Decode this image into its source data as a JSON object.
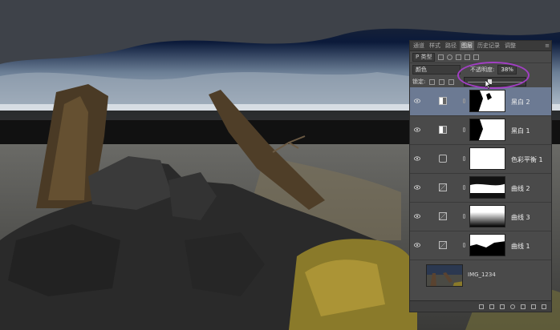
{
  "panel": {
    "tabs": [
      "通道",
      "样式",
      "路径",
      "图层",
      "历史记录",
      "调整"
    ],
    "active_tab": "图层",
    "kind_filter": "P 类型",
    "blend_mode": "颜色",
    "opacity_label": "不透明度:",
    "opacity_value": "38%",
    "lock_label": "锁定:",
    "opacity_slider": 0.38,
    "layers": [
      {
        "name": "黑白 2",
        "selected": true
      },
      {
        "name": "黑白 1",
        "selected": false
      },
      {
        "name": "色彩平衡 1",
        "selected": false
      },
      {
        "name": "曲线 2",
        "selected": false
      },
      {
        "name": "曲线 3",
        "selected": false
      },
      {
        "name": "曲线 1",
        "selected": false
      }
    ],
    "background_layer": "IMG_1234"
  },
  "colors": {
    "highlight_ring": "#a23fc4",
    "selected_row": "#6c7a93"
  }
}
